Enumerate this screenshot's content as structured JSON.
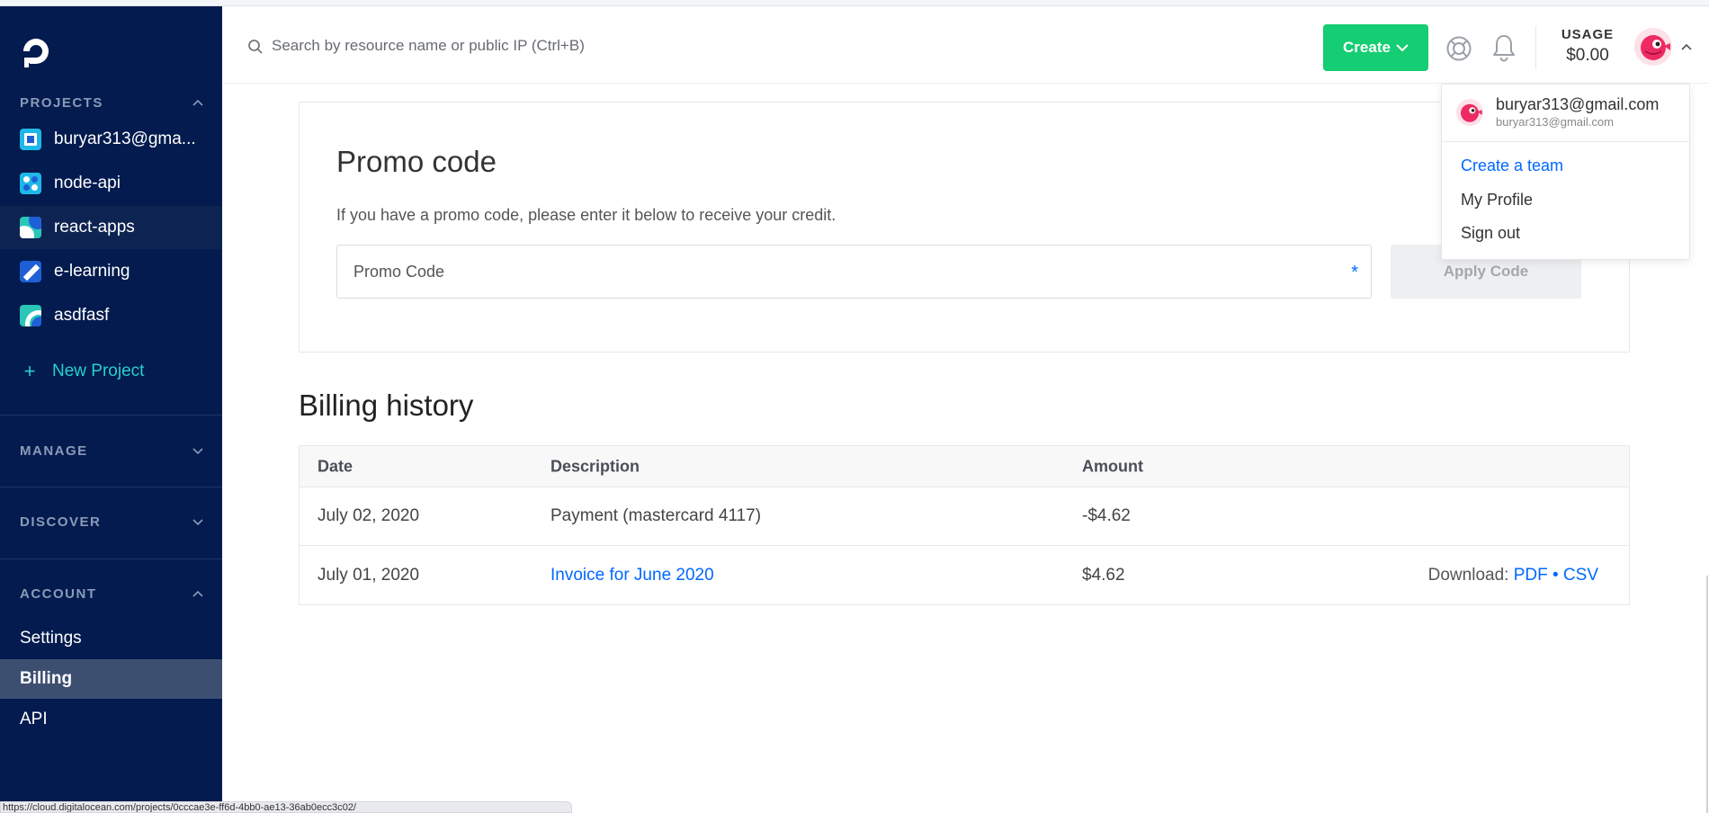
{
  "sidebar": {
    "sections": {
      "projects": "PROJECTS",
      "manage": "MANAGE",
      "discover": "DISCOVER",
      "account": "ACCOUNT"
    },
    "projects": [
      {
        "label": "buryar313@gma..."
      },
      {
        "label": "node-api"
      },
      {
        "label": "react-apps"
      },
      {
        "label": "e-learning"
      },
      {
        "label": "asdfasf"
      }
    ],
    "new_project": "New Project",
    "account_items": [
      {
        "label": "Settings"
      },
      {
        "label": "Billing"
      },
      {
        "label": "API"
      }
    ]
  },
  "header": {
    "search_placeholder": "Search by resource name or public IP (Ctrl+B)",
    "create_label": "Create",
    "usage_label": "USAGE",
    "usage_value": "$0.00"
  },
  "promo": {
    "title": "Promo code",
    "description": "If you have a promo code, please enter it below to receive your credit.",
    "input_placeholder": "Promo Code",
    "required_mark": "*",
    "apply_label": "Apply Code"
  },
  "billing": {
    "title": "Billing history",
    "columns": {
      "date": "Date",
      "description": "Description",
      "amount": "Amount"
    },
    "rows": [
      {
        "date": "July 02, 2020",
        "description": "Payment (mastercard 4117)",
        "amount": "-$4.62"
      },
      {
        "date": "July 01, 2020",
        "description": "Invoice for June 2020",
        "amount": "$4.62",
        "download_label": "Download:",
        "pdf": "PDF",
        "dot": "•",
        "csv": "CSV"
      }
    ]
  },
  "dropdown": {
    "email": "buryar313@gmail.com",
    "sub_email": "buryar313@gmail.com",
    "create_team": "Create a team",
    "my_profile": "My Profile",
    "sign_out": "Sign out"
  },
  "status_bar": {
    "url": "https://cloud.digitalocean.com/projects/0cccae3e-ff6d-4bb0-ae13-36ab0ecc3c02/"
  },
  "colors": {
    "sidebar_bg": "#031b4e",
    "accent_green": "#15cd72",
    "link_blue": "#0069ff",
    "teal": "#26d1cc"
  }
}
